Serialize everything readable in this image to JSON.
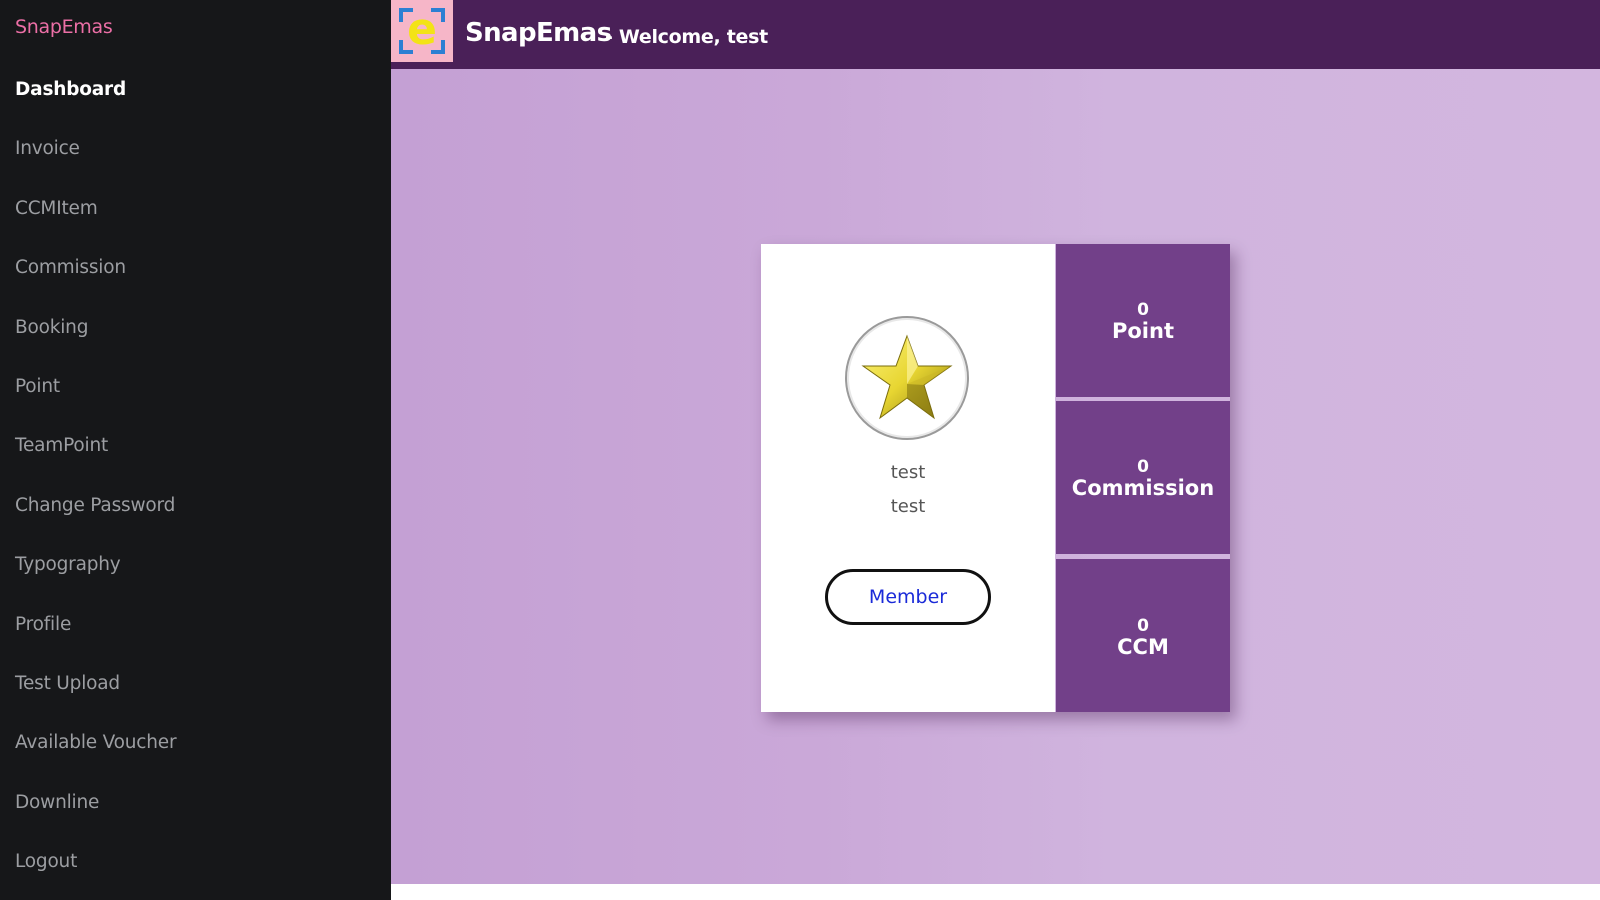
{
  "sidebar": {
    "brand": "SnapEmas",
    "items": [
      {
        "label": "Dashboard",
        "active": true
      },
      {
        "label": "Invoice"
      },
      {
        "label": "CCMItem"
      },
      {
        "label": "Commission"
      },
      {
        "label": "Booking"
      },
      {
        "label": "Point"
      },
      {
        "label": "TeamPoint"
      },
      {
        "label": "Change Password"
      },
      {
        "label": "Typography"
      },
      {
        "label": "Profile"
      },
      {
        "label": "Test Upload"
      },
      {
        "label": "Available Voucher"
      },
      {
        "label": "Downline"
      },
      {
        "label": "Logout"
      }
    ]
  },
  "header": {
    "logo_letter": "e",
    "title": "SnapEmas",
    "welcome": "- Welcome, test"
  },
  "profile": {
    "avatar_icon": "star-icon",
    "name": "test",
    "username": "test",
    "role_button": "Member"
  },
  "stats": [
    {
      "value": "0",
      "label": "Point"
    },
    {
      "value": "0",
      "label": "Commission"
    },
    {
      "value": "0",
      "label": "CCM"
    }
  ],
  "colors": {
    "sidebar_bg": "#161719",
    "brand": "#ec6fa6",
    "header_bg": "#4a2058",
    "stat_bg": "#724089",
    "member_text": "#1a2ad8"
  }
}
